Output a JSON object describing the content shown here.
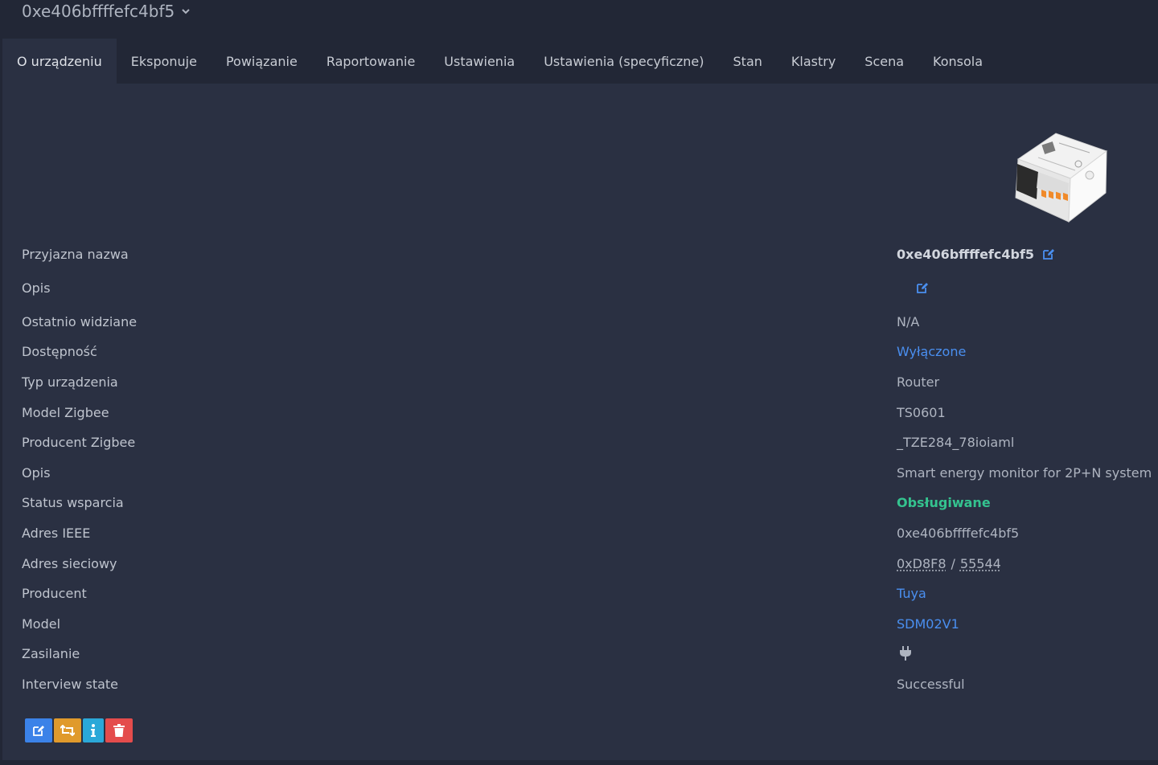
{
  "header": {
    "device_title": "0xe406bffffefc4bf5"
  },
  "tabs": [
    {
      "label": "O urządzeniu",
      "active": true
    },
    {
      "label": "Eksponuje"
    },
    {
      "label": "Powiązanie"
    },
    {
      "label": "Raportowanie"
    },
    {
      "label": "Ustawienia"
    },
    {
      "label": "Ustawienia (specyficzne)"
    },
    {
      "label": "Stan"
    },
    {
      "label": "Klastry"
    },
    {
      "label": "Scena"
    },
    {
      "label": "Konsola"
    }
  ],
  "details": {
    "friendly_name": {
      "label": "Przyjazna nazwa",
      "value": "0xe406bffffefc4bf5"
    },
    "description_edit": {
      "label": "Opis",
      "value": ""
    },
    "last_seen": {
      "label": "Ostatnio widziane",
      "value": "N/A"
    },
    "availability": {
      "label": "Dostępność",
      "value": "Wyłączone"
    },
    "device_type": {
      "label": "Typ urządzenia",
      "value": "Router"
    },
    "zigbee_model": {
      "label": "Model Zigbee",
      "value": "TS0601"
    },
    "zigbee_manufacturer": {
      "label": "Producent Zigbee",
      "value": "_TZE284_78ioiaml"
    },
    "description": {
      "label": "Opis",
      "value": "Smart energy monitor for 2P+N system"
    },
    "support_status": {
      "label": "Status wsparcia",
      "value": "Obsługiwane"
    },
    "ieee_address": {
      "label": "Adres IEEE",
      "value": "0xe406bffffefc4bf5"
    },
    "network_address": {
      "label": "Adres sieciowy",
      "hex": "0xD8F8",
      "separator": "/",
      "dec": "55544"
    },
    "vendor": {
      "label": "Producent",
      "value": "Tuya"
    },
    "model": {
      "label": "Model",
      "value": "SDM02V1"
    },
    "power_source": {
      "label": "Zasilanie",
      "icon": "plug-icon"
    },
    "interview_state": {
      "label": "Interview state",
      "value": "Successful"
    }
  },
  "actions": {
    "edit_icon": "edit-icon",
    "reconfigure_icon": "retweet-icon",
    "info_icon": "info-icon",
    "delete_icon": "trash-icon"
  },
  "colors": {
    "link": "#4a8ff0",
    "success": "#34c38f",
    "btn_edit": "#3b82e8",
    "btn_reconfigure": "#e09a2c",
    "btn_info": "#2ba8d8",
    "btn_delete": "#e44c4c"
  }
}
